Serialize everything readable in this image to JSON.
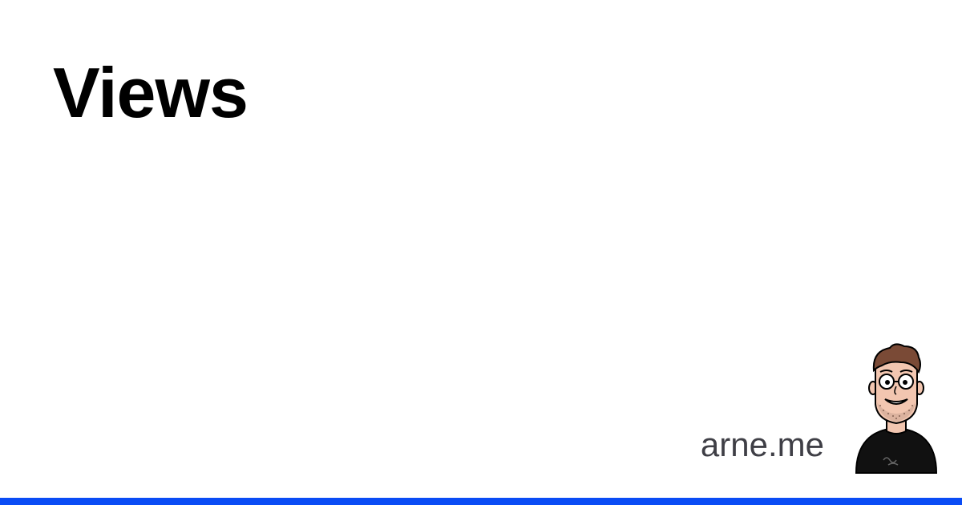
{
  "page": {
    "title": "Views",
    "site_name": "arne.me"
  },
  "colors": {
    "background": "#ffffff",
    "title": "#000000",
    "site_name": "#3f3f46",
    "accent_bar": "#0a4cf5"
  },
  "icons": {
    "avatar": "cartoon-portrait-icon"
  }
}
